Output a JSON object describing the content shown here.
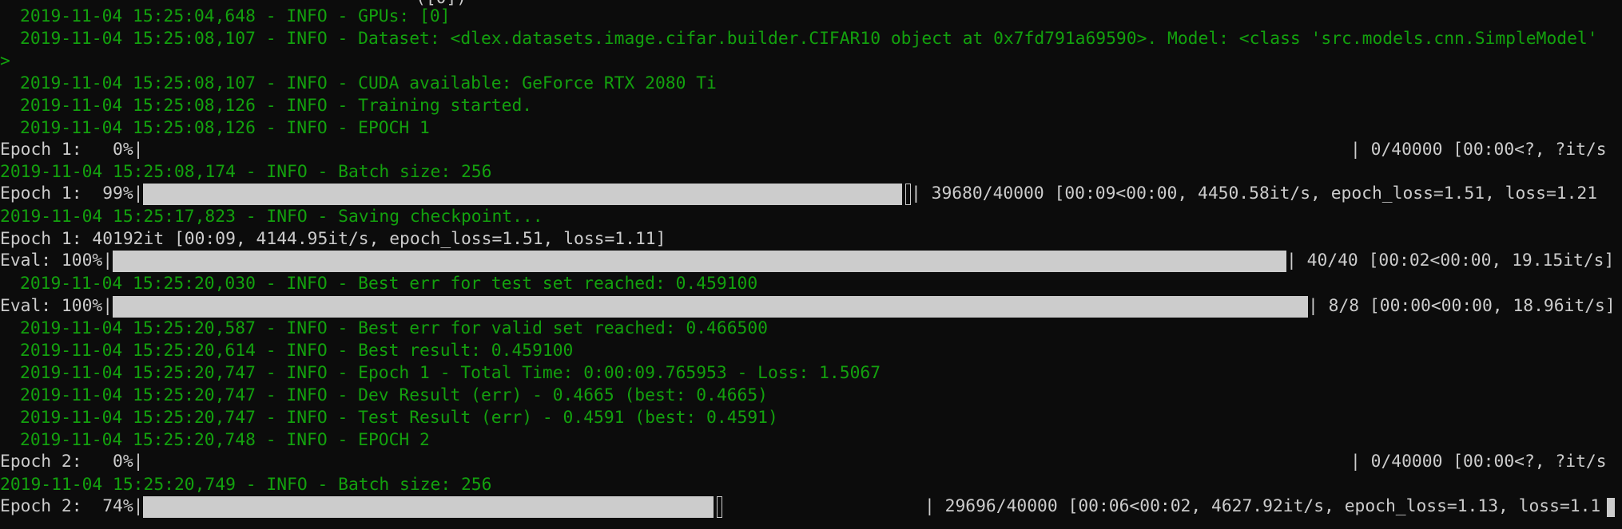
{
  "window": {
    "top_clipped_text": "([0])"
  },
  "lines": {
    "l01": "2019-11-04 15:25:04,648 - INFO - GPUs: [0]",
    "l02": "2019-11-04 15:25:08,107 - INFO - Dataset: <dlex.datasets.image.cifar.builder.CIFAR10 object at 0x7fd791a69590>. Model: <class 'src.models.cnn.SimpleModel'",
    "l03": ">",
    "l04": "2019-11-04 15:25:08,107 - INFO - CUDA available: GeForce RTX 2080 Ti",
    "l05": "2019-11-04 15:25:08,126 - INFO - Training started.",
    "l06": "2019-11-04 15:25:08,126 - INFO - EPOCH 1",
    "l07_left": "Epoch 1:   0%|",
    "l07_right": "| 0/40000 [00:00<?, ?it/s",
    "l08": "2019-11-04 15:25:08,174 - INFO - Batch size: 256",
    "l09_left": "Epoch 1:  99%|",
    "l09_right": "| 39680/40000 [00:09<00:00, 4450.58it/s, epoch_loss=1.51, loss=1.21",
    "l10": "2019-11-04 15:25:17,823 - INFO - Saving checkpoint...",
    "l11": "Epoch 1: 40192it [00:09, 4144.95it/s, epoch_loss=1.51, loss=1.11]",
    "l12_left": "Eval: 100%|",
    "l12_right": "| 40/40 [00:02<00:00, 19.15it/s]",
    "l13": "2019-11-04 15:25:20,030 - INFO - Best err for test set reached: 0.459100",
    "l14_left": "Eval: 100%|",
    "l14_right": "| 8/8 [00:00<00:00, 18.96it/s]",
    "l15": "2019-11-04 15:25:20,587 - INFO - Best err for valid set reached: 0.466500",
    "l16": "2019-11-04 15:25:20,614 - INFO - Best result: 0.459100",
    "l17": "2019-11-04 15:25:20,747 - INFO - Epoch 1 - Total Time: 0:00:09.765953 - Loss: 1.5067",
    "l18": "2019-11-04 15:25:20,747 - INFO - Dev Result (err) - 0.4665 (best: 0.4665)",
    "l19": "2019-11-04 15:25:20,747 - INFO - Test Result (err) - 0.4591 (best: 0.4591)",
    "l20": "2019-11-04 15:25:20,748 - INFO - EPOCH 2",
    "l21_left": "Epoch 2:   0%|",
    "l21_right": "| 0/40000 [00:00<?, ?it/s",
    "l22": "2019-11-04 15:25:20,749 - INFO - Batch size: 256",
    "l23_left": "Epoch 2:  74%|",
    "l23_right": "| 29696/40000 [00:06<00:02, 4627.92it/s, epoch_loss=1.13, loss=1.1"
  },
  "progress": {
    "epoch1_start": 0.0,
    "epoch1_mid": 0.99,
    "eval_test": 1.0,
    "eval_valid": 1.0,
    "epoch2_start": 0.0,
    "epoch2_mid": 0.74
  },
  "colors": {
    "background": "#0c0c0c",
    "log_green": "#13a10e",
    "text": "#cccccc"
  }
}
